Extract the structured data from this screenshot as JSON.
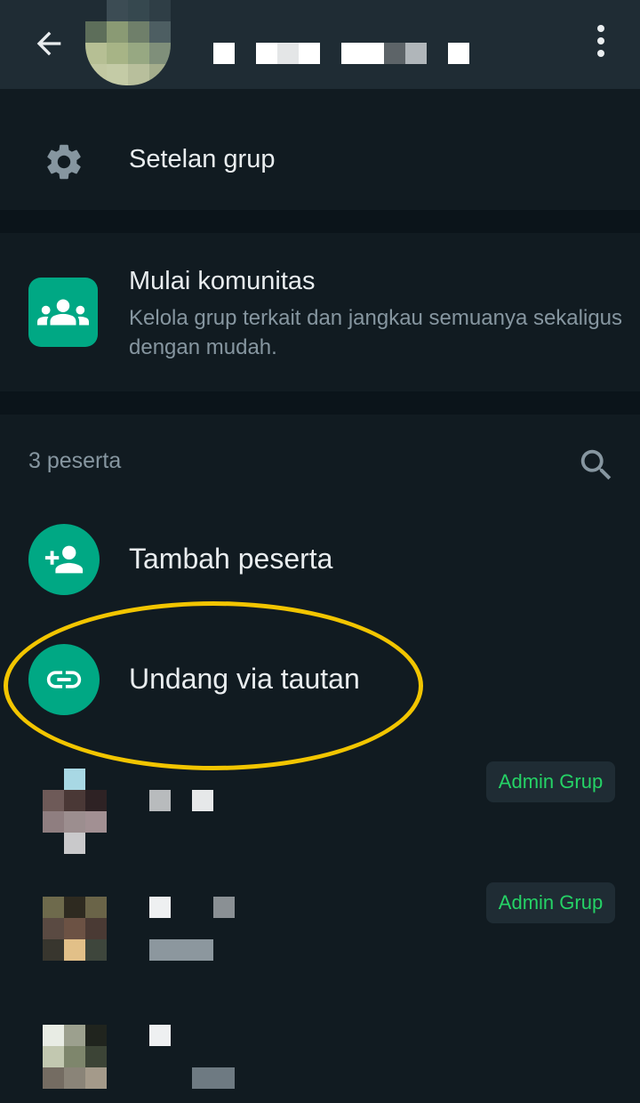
{
  "header": {
    "back_icon": "arrow-left-icon",
    "menu_icon": "more-vert-icon"
  },
  "settings": {
    "icon": "gear-icon",
    "label": "Setelan grup"
  },
  "community": {
    "icon": "community-icon",
    "title": "Mulai komunitas",
    "description": "Kelola grup terkait dan jangkau semuanya sekaligus dengan mudah."
  },
  "participants": {
    "count_label": "3 peserta",
    "search_icon": "search-icon",
    "actions": [
      {
        "icon": "add-person-icon",
        "label": "Tambah peserta"
      },
      {
        "icon": "link-icon",
        "label": "Undang via tautan"
      }
    ],
    "members": [
      {
        "badge": "Admin Grup"
      },
      {
        "badge": "Admin Grup"
      },
      {
        "badge": ""
      }
    ]
  },
  "colors": {
    "accent": "#00a884",
    "highlight": "#f2c500",
    "badge_text": "#25d366",
    "background": "#111b21",
    "header": "#1f2c34"
  }
}
